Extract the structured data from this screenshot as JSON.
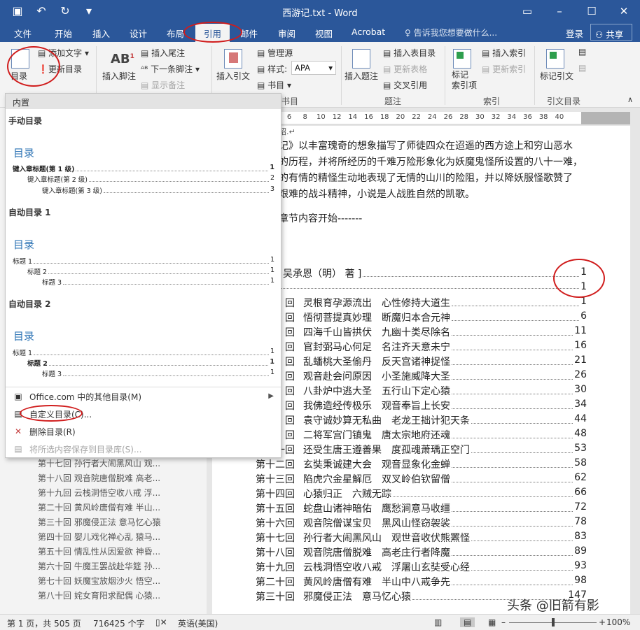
{
  "titlebar": {
    "title": "西游记.txt - Word",
    "qat_icons": [
      "save-icon",
      "undo-icon",
      "redo-icon",
      "customize-icon"
    ],
    "controls": [
      "minimize-icon",
      "restore-icon",
      "maximize-icon",
      "close-icon"
    ]
  },
  "tabs": [
    "文件",
    "开始",
    "插入",
    "设计",
    "布局",
    "引用",
    "邮件",
    "审阅",
    "视图",
    "Acrobat"
  ],
  "active_tab": "引用",
  "tellme": "告诉我您想要做什么...",
  "login": "登录",
  "share": "共享",
  "ribbon": {
    "toc_btn": "目录",
    "add_text": "添加文字",
    "update_toc": "更新目录",
    "insert_footnote": "插入脚注",
    "insert_endnote": "插入尾注",
    "next_footnote": "下一条脚注",
    "show_notes": "显示备注",
    "insert_citation": "插入引文",
    "manage_sources": "管理源",
    "style_label": "样式:",
    "style_value": "APA",
    "bibliography": "书目",
    "insert_caption": "插入题注",
    "insert_table_of_figures": "插入表目录",
    "update_table": "更新表格",
    "cross_reference": "交叉引用",
    "mark_entry": "标记\n索引项",
    "insert_index": "插入索引",
    "update_index": "更新索引",
    "mark_citation": "标记引文",
    "groups": {
      "citations": "书目",
      "captions": "题注",
      "index": "索引",
      "authorities": "引文目录"
    }
  },
  "ruler": [
    "6",
    "8",
    "10",
    "12",
    "14",
    "16",
    "18",
    "20",
    "22",
    "24",
    "26",
    "28",
    "30",
    "32",
    "34",
    "36",
    "38",
    "40"
  ],
  "gallery": {
    "header": "内置",
    "manual": "手动目录",
    "auto1": "自动目录 1",
    "auto2": "自动目录 2",
    "toc_title": "目录",
    "manual_rows": [
      {
        "text": "键入章标题(第 1 级)",
        "page": "1"
      },
      {
        "text": "键入章标题(第 2 级)",
        "page": "2"
      },
      {
        "text": "键入章标题(第 3 级)",
        "page": "3"
      }
    ],
    "auto_rows": [
      {
        "text": "标题 1",
        "page": "1"
      },
      {
        "text": "标题 2",
        "page": "1"
      },
      {
        "text": "标题 3",
        "page": "1"
      }
    ],
    "menu": {
      "office_more": "Office.com 中的其他目录(M)",
      "custom": "自定义目录(C)...",
      "remove": "删除目录(R)",
      "save_selection": "将所选内容保存到目录库(S)..."
    }
  },
  "nav_items": [
    "第十七回 孙行者大闹黑风山 观...",
    "第十八回 观音院唐僧脱难 高老...",
    "第十九回 云栈洞悟空收八戒 浮...",
    "第二十回 黄风岭唐僧有难 半山...",
    "第三十回 邪魔侵正法 意马忆心猿",
    "第四十回 婴儿戏化禅心乱 猿马...",
    "第五十回 情乱性从因爱欲 神昏...",
    "第六十回 牛魔王罢战赴华筵 孙...",
    "第七十回 妖魔宝放烟沙火 悟空...",
    "第八十回 姹女育阳求配偶 心猿..."
  ],
  "doc": {
    "para1": "记》以丰富瑰奇的想象描写了师徒四众在迢遥的西方途上和穷山恶水",
    "para2": "的历程，并将所经历的千难万险形象化为妖魔鬼怪所设置的八十一难，",
    "para3": "的有情的精怪生动地表现了无情的山川的险阻，并以降妖服怪歌赞了",
    "para4": "艰难的战斗精神，小说是人战胜自然的凯歌。",
    "chapter_start": "章节内容开始-------",
    "author_line": "吴承恩（明） 著 ]",
    "blank_row_page": "1",
    "toc": [
      {
        "num": "回",
        "title": "灵根育孕源流出　心性修持大道生",
        "page": "1"
      },
      {
        "num": "回",
        "title": "悟彻菩提真妙理　断魔归本合元神",
        "page": "6"
      },
      {
        "num": "回",
        "title": "四海千山皆拱伏　九幽十类尽除名",
        "page": "11"
      },
      {
        "num": "回",
        "title": "官封弼马心何足　名注齐天意未宁",
        "page": "16"
      },
      {
        "num": "回",
        "title": "乱蟠桃大圣偷丹　反天宫诸神捉怪",
        "page": "21"
      },
      {
        "num": "回",
        "title": "观音赴会问原因　小圣施威降大圣",
        "page": "26"
      },
      {
        "num": "回",
        "title": "八卦炉中逃大圣　五行山下定心猿",
        "page": "30"
      },
      {
        "num": "回",
        "title": "我佛造经传极乐　观音奉旨上长安",
        "page": "34"
      },
      {
        "num": "回",
        "title": "袁守诚妙算无私曲　老龙王拙计犯天条",
        "page": "44"
      },
      {
        "num": "回",
        "title": "二将军宫门镇鬼　唐太宗地府还魂",
        "page": "48"
      },
      {
        "num": "一回",
        "title": "还受生唐王遵善果　度孤魂萧瑀正空门",
        "page": "53"
      },
      {
        "num": "第十二回",
        "title": "玄奘秉诚建大会　观音显象化金蝉",
        "page": "58"
      },
      {
        "num": "第十三回",
        "title": "陷虎穴金星解厄　双叉岭伯钦留僧",
        "page": "62"
      },
      {
        "num": "第十四回",
        "title": "心猿归正　六贼无踪",
        "page": "66"
      },
      {
        "num": "第十五回",
        "title": "蛇盘山诸神暗佑　鹰愁涧意马收缰",
        "page": "72"
      },
      {
        "num": "第十六回",
        "title": "观音院僧谋宝贝　黑风山怪窃袈裟",
        "page": "78"
      },
      {
        "num": "第十七回",
        "title": "孙行者大闹黑风山　观世音收伏熊罴怪",
        "page": "83"
      },
      {
        "num": "第十八回",
        "title": "观音院唐僧脱难　高老庄行者降魔",
        "page": "89"
      },
      {
        "num": "第十九回",
        "title": "云栈洞悟空收八戒　浮屠山玄奘受心经",
        "page": "93"
      },
      {
        "num": "第二十回",
        "title": "黄风岭唐僧有难　半山中八戒争先",
        "page": "98"
      },
      {
        "num": "第三十回",
        "title": "邪魔侵正法　意马忆心猿",
        "page": "147"
      }
    ]
  },
  "status": {
    "page": "第 1 页，共 505 页",
    "words": "716425 个字",
    "lang": "英语(美国)",
    "zoom": "100%",
    "zoom_level": 0.5
  },
  "watermark": "头条 @旧箭有影"
}
